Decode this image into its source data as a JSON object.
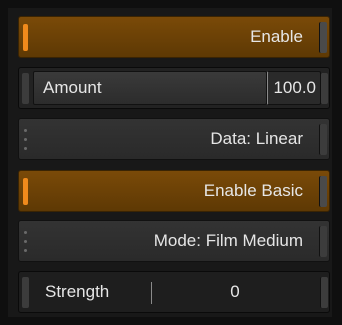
{
  "controls": {
    "enable": {
      "label": "Enable",
      "on": true
    },
    "amount": {
      "label": "Amount",
      "value": "100.0"
    },
    "data": {
      "label": "Data: Linear"
    },
    "enable_basic": {
      "label": "Enable Basic",
      "on": true
    },
    "mode": {
      "label": "Mode: Film Medium"
    },
    "strength": {
      "label": "Strength",
      "value": "0"
    }
  },
  "colors": {
    "accent": "#f08a1c",
    "toggle_bg": "#6a4106",
    "panel": "#181818"
  }
}
